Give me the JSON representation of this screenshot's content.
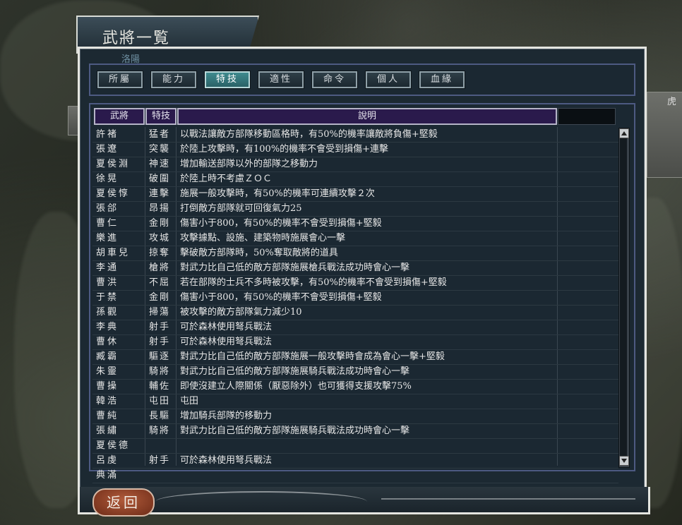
{
  "window": {
    "title": "武將一覧",
    "subtitle": "洛陽",
    "map_label": "虎"
  },
  "tabs": [
    {
      "label": "所屬",
      "active": false
    },
    {
      "label": "能力",
      "active": false
    },
    {
      "label": "特技",
      "active": true
    },
    {
      "label": "適性",
      "active": false
    },
    {
      "label": "命令",
      "active": false
    },
    {
      "label": "個人",
      "active": false
    },
    {
      "label": "血緣",
      "active": false
    }
  ],
  "table": {
    "headers": {
      "name": "武將",
      "skill": "特技",
      "desc": "說明"
    },
    "rows": [
      {
        "name": "許褚",
        "skill": "猛者",
        "desc": "以戰法讓敵方部隊移動區格時，有50%的機率讓敵將負傷+堅毅"
      },
      {
        "name": "張遼",
        "skill": "突襲",
        "desc": "於陸上攻擊時，有100%的機率不會受到損傷+連擊"
      },
      {
        "name": "夏侯淵",
        "skill": "神速",
        "desc": "增加輸送部隊以外的部隊之移動力"
      },
      {
        "name": "徐晃",
        "skill": "破圍",
        "desc": "於陸上時不考慮ＺＯＣ"
      },
      {
        "name": "夏侯惇",
        "skill": "連擊",
        "desc": "施展一般攻擊時，有50%的機率可連續攻擊２次"
      },
      {
        "name": "張郃",
        "skill": "昂揚",
        "desc": "打倒敵方部隊就可回復氣力25"
      },
      {
        "name": "曹仁",
        "skill": "金剛",
        "desc": "傷害小于800，有50%的機率不會受到損傷+堅毅"
      },
      {
        "name": "樂進",
        "skill": "攻城",
        "desc": "攻擊據點、設施、建築物時施展會心一擊"
      },
      {
        "name": "胡車兒",
        "skill": "掠奪",
        "desc": "擊破敵方部隊時，50%奪取敵將的道具"
      },
      {
        "name": "李通",
        "skill": "槍將",
        "desc": "對武力比自己低的敵方部隊施展槍兵戰法成功時會心一擊"
      },
      {
        "name": "曹洪",
        "skill": "不屈",
        "desc": "若在部隊的士兵不多時被攻擊，有50%的機率不會受到損傷+堅毅"
      },
      {
        "name": "于禁",
        "skill": "金剛",
        "desc": "傷害小于800，有50%的機率不會受到損傷+堅毅"
      },
      {
        "name": "孫觀",
        "skill": "掃蕩",
        "desc": "被攻擊的敵方部隊氣力減少10"
      },
      {
        "name": "李典",
        "skill": "射手",
        "desc": "可於森林使用弩兵戰法"
      },
      {
        "name": "曹休",
        "skill": "射手",
        "desc": "可於森林使用弩兵戰法"
      },
      {
        "name": "臧霸",
        "skill": "驅逐",
        "desc": "對武力比自己低的敵方部隊施展一般攻擊時會成為會心一擊+堅毅"
      },
      {
        "name": "朱靈",
        "skill": "騎將",
        "desc": "對武力比自己低的敵方部隊施展騎兵戰法成功時會心一擊"
      },
      {
        "name": "曹操",
        "skill": "輔佐",
        "desc": "即使沒建立人際關係（厭惡除外）也可獲得支援攻擊75%"
      },
      {
        "name": "韓浩",
        "skill": "屯田",
        "desc": "屯田"
      },
      {
        "name": "曹純",
        "skill": "長驅",
        "desc": "增加騎兵部隊的移動力"
      },
      {
        "name": "張繡",
        "skill": "騎將",
        "desc": "對武力比自己低的敵方部隊施展騎兵戰法成功時會心一擊"
      },
      {
        "name": "夏侯德",
        "skill": "",
        "desc": ""
      },
      {
        "name": "呂虔",
        "skill": "射手",
        "desc": "可於森林使用弩兵戰法"
      },
      {
        "name": "典滿",
        "skill": "",
        "desc": ""
      }
    ]
  },
  "footer": {
    "back_label": "返回"
  }
}
